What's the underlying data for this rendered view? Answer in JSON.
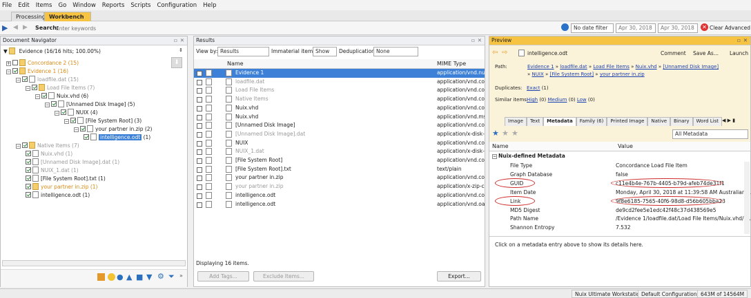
{
  "menu": [
    "File",
    "Edit",
    "Items",
    "Go",
    "Window",
    "Reports",
    "Scripts",
    "Configuration",
    "Help"
  ],
  "tabs": {
    "processing": "Processing",
    "workbench": "Workbench"
  },
  "search": {
    "label": "Search:",
    "placeholder": "Enter keywords",
    "date_filter": "No date filter",
    "date_from": "Apr 30, 2018",
    "date_to": "Apr 30, 2018",
    "clear": "Clear",
    "advanced": "Advanced"
  },
  "navigator": {
    "title": "Document Navigator",
    "summary": "Evidence (16/16 hits; 100.00%)",
    "items": [
      "Concordance 2  (15)",
      "Evidence 1  (16)",
      "loadfile.dat  (15)",
      "Load File Items  (7)",
      "Nuix.vhd  (6)",
      "[Unnamed Disk Image]  (5)",
      "NUIX  (4)",
      "[File System Root]  (3)",
      "your partner in.zip  (2)",
      "intelligence.odt",
      "(1)",
      "Native Items  (7)",
      "Nuix.vhd  (1)",
      "[Unnamed Disk Image].dat  (1)",
      "NUIX_1.dat  (1)",
      "[File System Root].txt  (1)",
      "your partner in.zip  (1)",
      "intelligence.odt  (1)"
    ]
  },
  "results": {
    "title": "Results",
    "view_by_label": "View by:",
    "view_by": "Results",
    "immaterial_label": "Immaterial items:",
    "immaterial": "Show",
    "dedup_label": "Deduplication:",
    "dedup": "None",
    "columns": {
      "name": "Name",
      "mime": "MIME Type"
    },
    "rows": [
      {
        "name": "Evidence 1",
        "mime": "application/vnd.nuix",
        "style": "sel"
      },
      {
        "name": "loadfile.dat",
        "mime": "application/vnd.conc",
        "style": "gray"
      },
      {
        "name": "Load File Items",
        "mime": "application/vnd.conc",
        "style": "gray"
      },
      {
        "name": "Native Items",
        "mime": "application/vnd.conc",
        "style": "gray"
      },
      {
        "name": "Nuix.vhd",
        "mime": "application/vnd.conc",
        "style": ""
      },
      {
        "name": "Nuix.vhd",
        "mime": "application/vnd.ms-v",
        "style": ""
      },
      {
        "name": "[Unnamed Disk Image]",
        "mime": "application/vnd.conc",
        "style": ""
      },
      {
        "name": "[Unnamed Disk Image].dat",
        "mime": "application/x-disk-in",
        "style": "gray"
      },
      {
        "name": "NUIX",
        "mime": "application/vnd.conc",
        "style": ""
      },
      {
        "name": "NUIX_1.dat",
        "mime": "application/x-disk-in",
        "style": "gray"
      },
      {
        "name": "[File System Root]",
        "mime": "application/vnd.conc",
        "style": ""
      },
      {
        "name": "[File System Root].txt",
        "mime": "text/plain",
        "style": ""
      },
      {
        "name": "your partner in.zip",
        "mime": "application/vnd.conc",
        "style": ""
      },
      {
        "name": "your partner in.zip",
        "mime": "application/x-zip-com",
        "style": "gray"
      },
      {
        "name": "intelligence.odt",
        "mime": "application/vnd.conc",
        "style": ""
      },
      {
        "name": "intelligence.odt",
        "mime": "application/vnd.oasi",
        "style": ""
      }
    ],
    "status": "Displaying 16 items.",
    "add_tags": "Add Tags...",
    "exclude": "Exclude Items...",
    "export": "Export..."
  },
  "preview": {
    "title": "Preview",
    "filename": "intelligence.odt",
    "comment": "Comment",
    "save_as": "Save As...",
    "launch": "Launch",
    "path_label": "Path:",
    "path_line1": [
      "Evidence 1",
      "loadfile.dat",
      "Load File Items",
      "Nuix.vhd",
      "[Unnamed Disk Image]"
    ],
    "path_line2": [
      "NUIX",
      "[File System Root]",
      "your partner in.zip"
    ],
    "duplicates_label": "Duplicates:",
    "duplicates_exact": "Exact",
    "duplicates_exact_count": "(1)",
    "similar_label": "Similar items:",
    "similar_high": "High",
    "similar_high_count": "(0)",
    "similar_medium": "Medium",
    "similar_medium_count": "(0)",
    "similar_low": "Low",
    "similar_low_count": "(0)",
    "tabs": [
      "Image",
      "Text",
      "Metadata",
      "Family (6)",
      "Printed Image",
      "Native",
      "Binary",
      "Word List"
    ],
    "filter": "All Metadata",
    "meta_cols": {
      "name": "Name",
      "value": "Value"
    },
    "meta_group": "Nuix-defined Metadata",
    "meta_rows": [
      {
        "name": "File Type",
        "value": "Concordance Load File Item"
      },
      {
        "name": "Graph Database",
        "value": "false"
      },
      {
        "name": "GUID",
        "value": "c11e4b4e-767b-4405-b79d-afeb74de31f1"
      },
      {
        "name": "Item Date",
        "value": "Monday, April 30, 2018 at 11:39:58 AM Australian ..."
      },
      {
        "name": "Link",
        "value": "9f8e6185-7565-40f6-98d8-d56b605bba23"
      },
      {
        "name": "MD5 Digest",
        "value": "de9cd2fee5e1edc42f48c37d438569e5"
      },
      {
        "name": "Path Name",
        "value": "/Evidence 1/loadfile.dat/Load File Items/Nuix.vhd/[..."
      },
      {
        "name": "Shannon Entropy",
        "value": "7.532"
      }
    ],
    "details_hint": "Click on a metadata entry above to show its details here."
  },
  "statusbar": {
    "product": "Nuix Ultimate Workstation",
    "config": "Default Configuration",
    "memory": "643M of 14564M"
  }
}
